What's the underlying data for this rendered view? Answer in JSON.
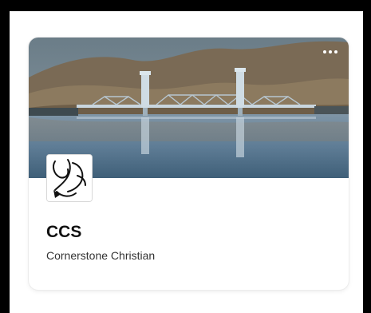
{
  "group_card": {
    "title": "CCS",
    "subtitle": "Cornerstone Christian",
    "cover_image": "bridge-over-river-photo",
    "avatar_image": "dove-logo",
    "menu_icon": "more-horizontal-icon"
  },
  "colors": {
    "page_background": "#ffffff",
    "frame": "#000000",
    "title_text": "#111111",
    "subtitle_text": "#333333",
    "menu_dots": "#ffffff"
  }
}
